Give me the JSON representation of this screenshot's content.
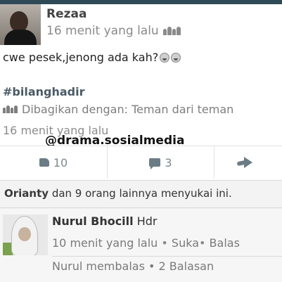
{
  "post": {
    "author": "Rezaa",
    "time": "16 menit yang lalu",
    "audience_icon": "friends-of-friends-icon",
    "text": "cwe pesek,jenong ada kah?",
    "emoji_icon": "laughing-face-emoji",
    "hashtag": "#bilanghadir",
    "shared_with": "Dibagikan dengan: Teman dari teman",
    "time_repeat": "16 menit yang lalu"
  },
  "watermark": "@drama.sosialmedia",
  "actions": {
    "like_count": "10",
    "comment_count": "3",
    "like_icon": "thumbs-up-icon",
    "comment_icon": "comment-icon",
    "share_icon": "share-arrow-icon"
  },
  "likes": {
    "name": "Orianty",
    "rest": " dan 9 orang lainnya menyukai ini."
  },
  "comment": {
    "name": "Nurul Bhocill",
    "text": " Hdr",
    "time": "10 menit yang lalu",
    "sep": " • ",
    "like_label": "Suka",
    "sep2": "• ",
    "reply_label": "Balas",
    "replies": "Nurul membalas • 2 Balasan"
  },
  "colors": {
    "topbar": "#2f4a57",
    "icon": "#6b7c85"
  }
}
